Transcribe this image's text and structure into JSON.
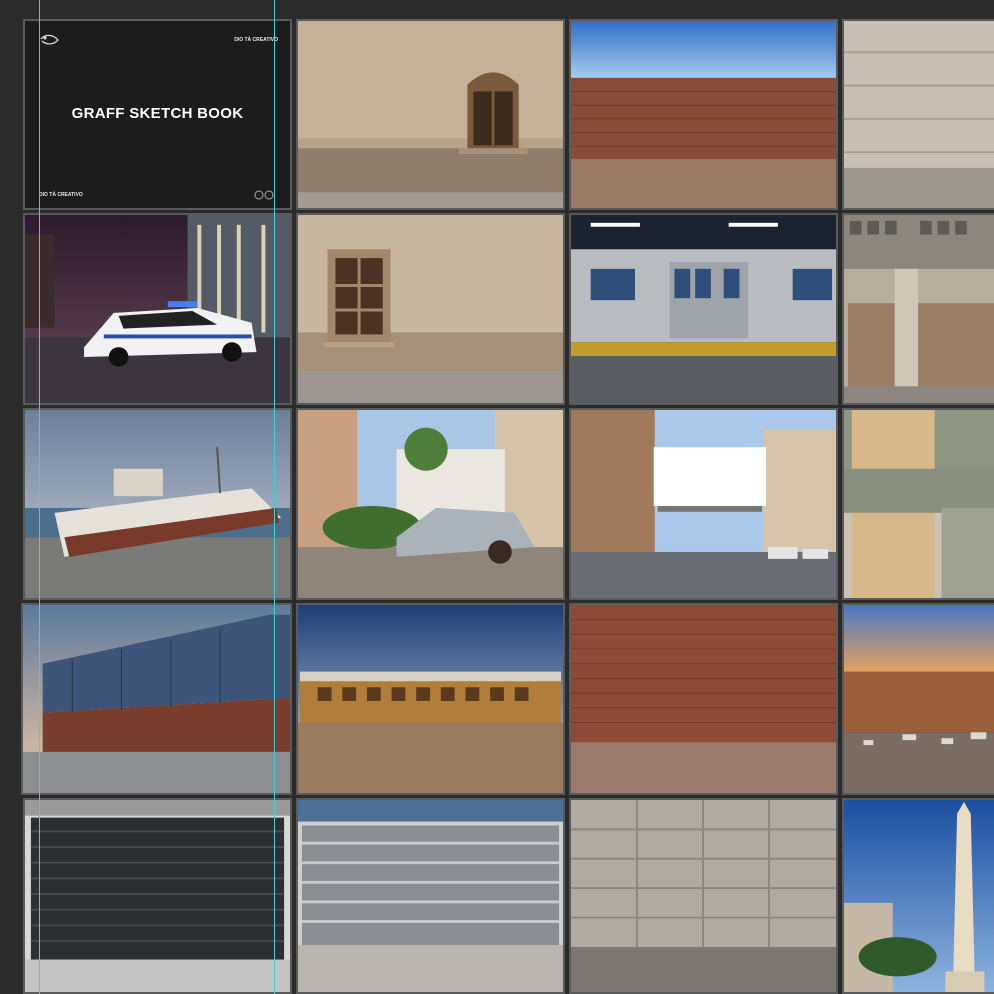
{
  "cover": {
    "title": "GRAFF SKETCH BOOK",
    "brand_top": "DIO TÀ CREATIVO",
    "brand_bottom": "DIO TÀ CREATIVO"
  },
  "thumbnails": [
    "cover",
    "stucco-wall-with-arched-window",
    "brick-wall-blue-sky",
    "concrete-panel-wall",
    "police-car-at-night",
    "stucco-wall-with-window",
    "subway-train-doors",
    "rolling-shutters-facade",
    "rusty-ship-on-shore",
    "abandoned-car-in-plaza",
    "blank-billboard-street",
    "concrete-overpass-pillars",
    "shipping-containers",
    "old-train-wagon",
    "red-brick-wall",
    "brick-wall-with-trash",
    "dark-rolling-shutter",
    "silver-rolling-shutter",
    "concrete-block-wall",
    "obelisk-monument"
  ],
  "colors": {
    "canvas": "#2b2b2b",
    "thumb_border": "#5a5a5a",
    "guide": "#3fd0d8"
  }
}
